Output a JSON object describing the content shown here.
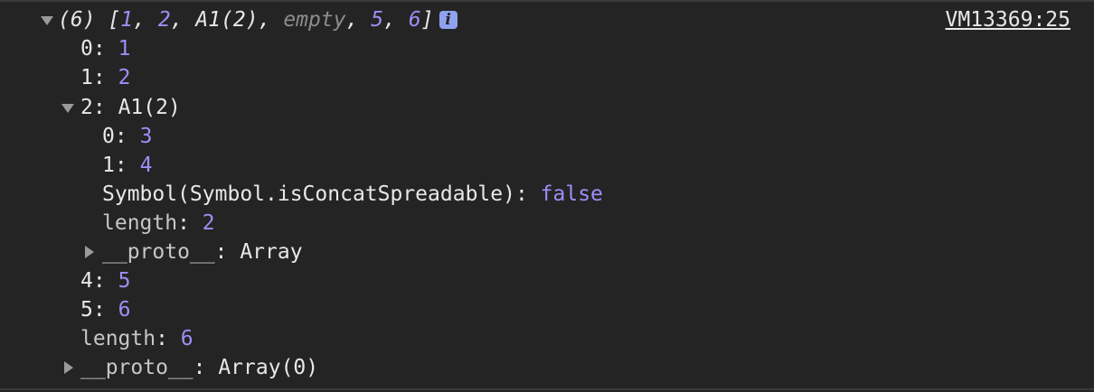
{
  "source_link": "VM13369:25",
  "info_icon": "i",
  "root": {
    "prefix": "(6) [",
    "items": [
      "1",
      "2",
      "A1(2)",
      "empty",
      "5",
      "6"
    ],
    "suffix": "]"
  },
  "rows": {
    "r0": {
      "key": "0",
      "value": "1"
    },
    "r1": {
      "key": "1",
      "value": "2"
    },
    "r2": {
      "key": "2",
      "value": "A1(2)"
    },
    "r2_0": {
      "key": "0",
      "value": "3"
    },
    "r2_1": {
      "key": "1",
      "value": "4"
    },
    "r2_sym": {
      "key": "Symbol(Symbol.isConcatSpreadable)",
      "value": "false"
    },
    "r2_len": {
      "key": "length",
      "value": "2"
    },
    "r2_proto": {
      "key": "__proto__",
      "value": "Array"
    },
    "r4": {
      "key": "4",
      "value": "5"
    },
    "r5": {
      "key": "5",
      "value": "6"
    },
    "rlen": {
      "key": "length",
      "value": "6"
    },
    "rproto": {
      "key": "__proto__",
      "value": "Array(0)"
    }
  },
  "separators": {
    "colon": ": ",
    "comma": ", "
  }
}
